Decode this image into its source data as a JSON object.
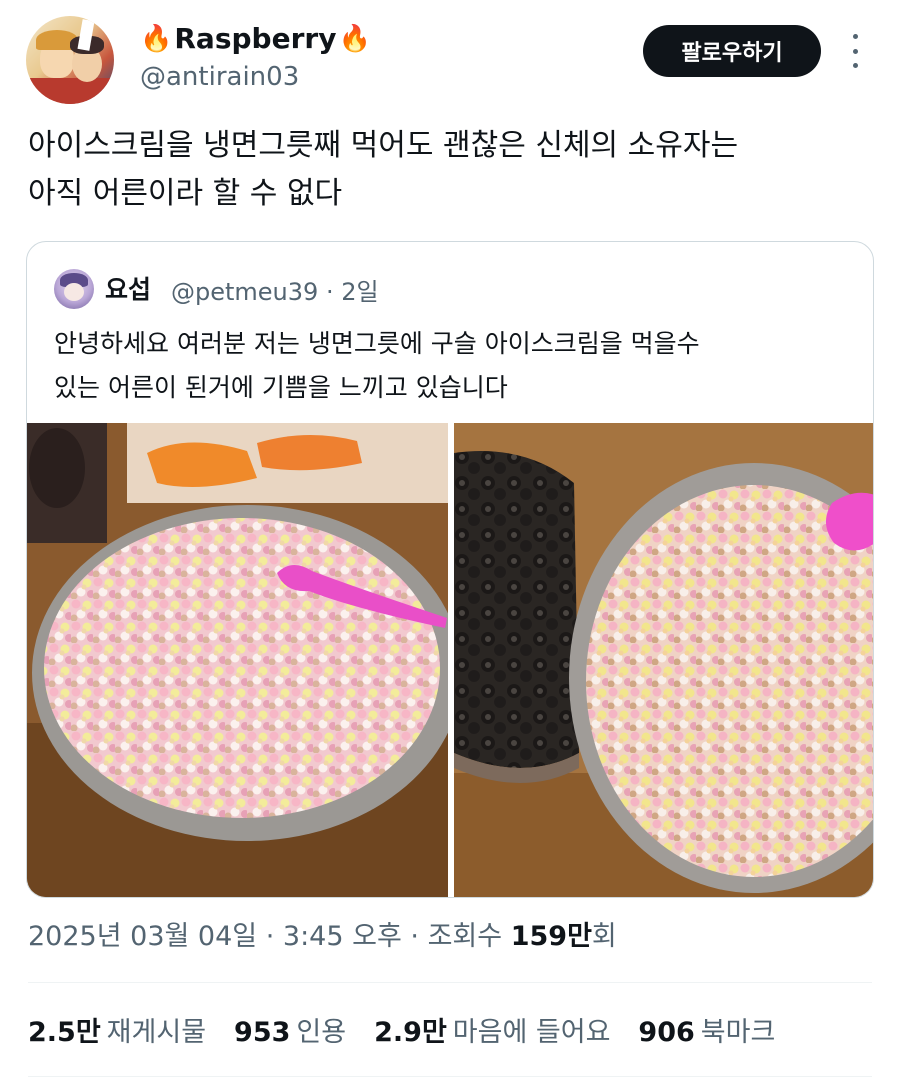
{
  "author": {
    "fire_left": "🔥",
    "name": "Raspberry",
    "fire_right": "🔥",
    "handle": "@antirain03"
  },
  "actions": {
    "follow_label": "팔로우하기"
  },
  "tweet": {
    "line1": "아이스크림을 냉면그릇째 먹어도 괜찮은  신체의 소유자는",
    "line2": "아직 어른이라 할 수 없다"
  },
  "quote": {
    "name": "요섭",
    "handle": "@petmeu39",
    "separator": "·",
    "time": "2일",
    "line1": "안녕하세요 여러분 저는 냉면그릇에 구슬 아이스크림을 먹을수",
    "line2": "있는 어른이 된거에 기쁨을 느끼고 있습니다"
  },
  "meta": {
    "date": "2025년 03월 04일",
    "sep1": "·",
    "time": "3:45 오후",
    "sep2": "·",
    "views_label": "조회수",
    "views_value": "159만",
    "views_suffix": "회"
  },
  "stats": [
    {
      "value": "2.5만",
      "label": "재게시물"
    },
    {
      "value": "953",
      "label": "인용"
    },
    {
      "value": "2.9만",
      "label": "마음에 들어요"
    },
    {
      "value": "906",
      "label": "북마크"
    }
  ]
}
